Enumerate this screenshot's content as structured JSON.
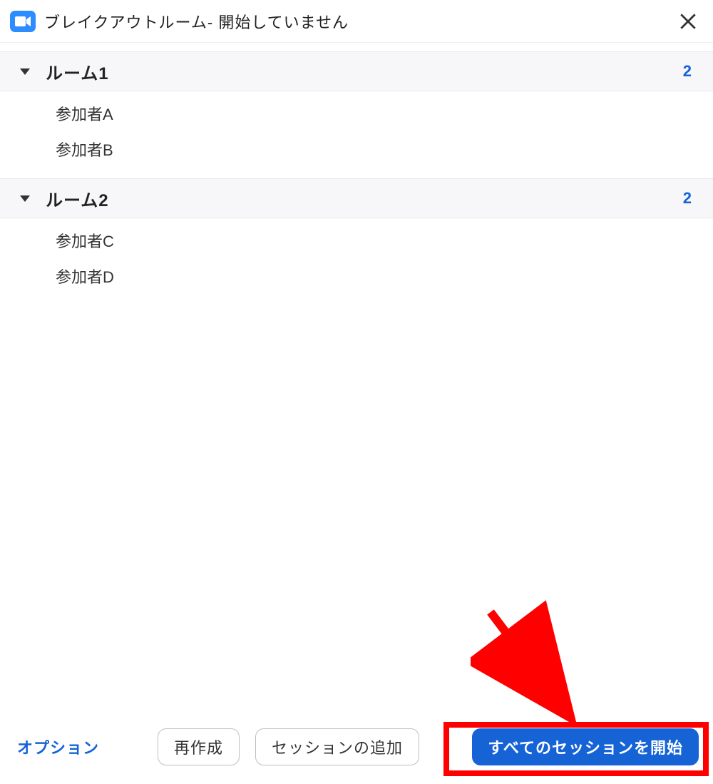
{
  "titlebar": {
    "text": "ブレイクアウトルーム- 開始していません",
    "app_icon_name": "camera-icon",
    "close_icon_name": "close-icon"
  },
  "rooms": [
    {
      "name": "ルーム1",
      "count": "2",
      "participants": [
        "参加者A",
        "参加者B"
      ]
    },
    {
      "name": "ルーム2",
      "count": "2",
      "participants": [
        "参加者C",
        "参加者D"
      ]
    }
  ],
  "footer": {
    "options_label": "オプション",
    "recreate_label": "再作成",
    "add_session_label": "セッションの追加",
    "start_all_label": "すべてのセッションを開始"
  },
  "annotation": {
    "highlight_target": "start-all-sessions-button",
    "arrow_icon_name": "red-arrow-icon"
  }
}
